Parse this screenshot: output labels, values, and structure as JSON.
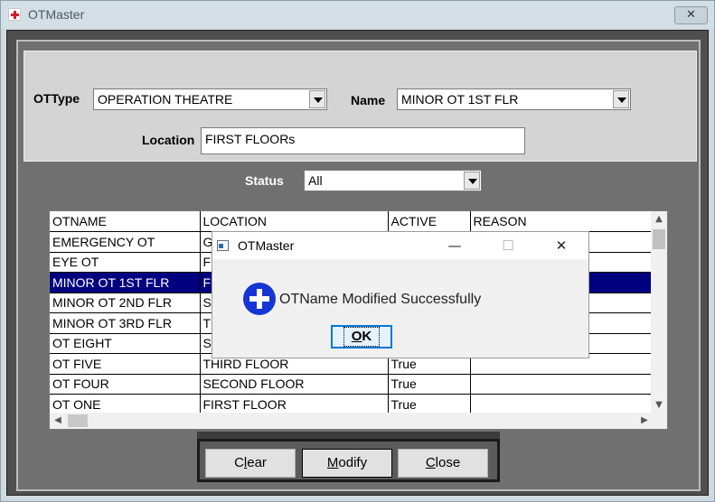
{
  "window": {
    "title": "OTMaster",
    "close_glyph": "✕"
  },
  "form": {
    "ottype_label": "OTType",
    "ottype_value": "OPERATION THEATRE",
    "name_label": "Name",
    "name_value": "MINOR OT 1ST FLR",
    "location_label": "Location",
    "location_value": "FIRST FLOORs",
    "status_label": "Status",
    "status_value": "All"
  },
  "grid": {
    "columns": [
      "OTNAME",
      "LOCATION",
      "ACTIVE",
      "REASON"
    ],
    "rows": [
      [
        "EMERGENCY OT",
        "G",
        "",
        ""
      ],
      [
        "EYE OT",
        "F",
        "",
        ""
      ],
      [
        "MINOR OT 1ST FLR",
        "F",
        "",
        ""
      ],
      [
        "MINOR OT 2ND FLR",
        "S",
        "",
        ""
      ],
      [
        "MINOR OT 3RD FLR",
        "T",
        "",
        ""
      ],
      [
        "OT EIGHT",
        "S",
        "",
        ""
      ],
      [
        "OT FIVE",
        "THIRD FLOOR",
        "True",
        ""
      ],
      [
        "OT FOUR",
        "SECOND FLOOR",
        "True",
        ""
      ],
      [
        "OT ONE",
        "FIRST FLOOR",
        "True",
        ""
      ]
    ],
    "selected_row": 2
  },
  "buttons": {
    "clear": {
      "pre": "C",
      "ul": "l",
      "post": "ear"
    },
    "modify": {
      "pre": "",
      "ul": "M",
      "post": "odify"
    },
    "close": {
      "pre": "",
      "ul": "C",
      "post": "lose"
    }
  },
  "dialog": {
    "title": "OTMaster",
    "message": "OTName Modified Successfully",
    "ok_pre": "",
    "ok_ul": "O",
    "ok_post": "K",
    "minimize_glyph": "—",
    "maximize_glyph": "☐",
    "close_glyph": "✕"
  },
  "icons": {
    "app": "red-cross-icon",
    "info": "blue-plus-info-icon"
  }
}
